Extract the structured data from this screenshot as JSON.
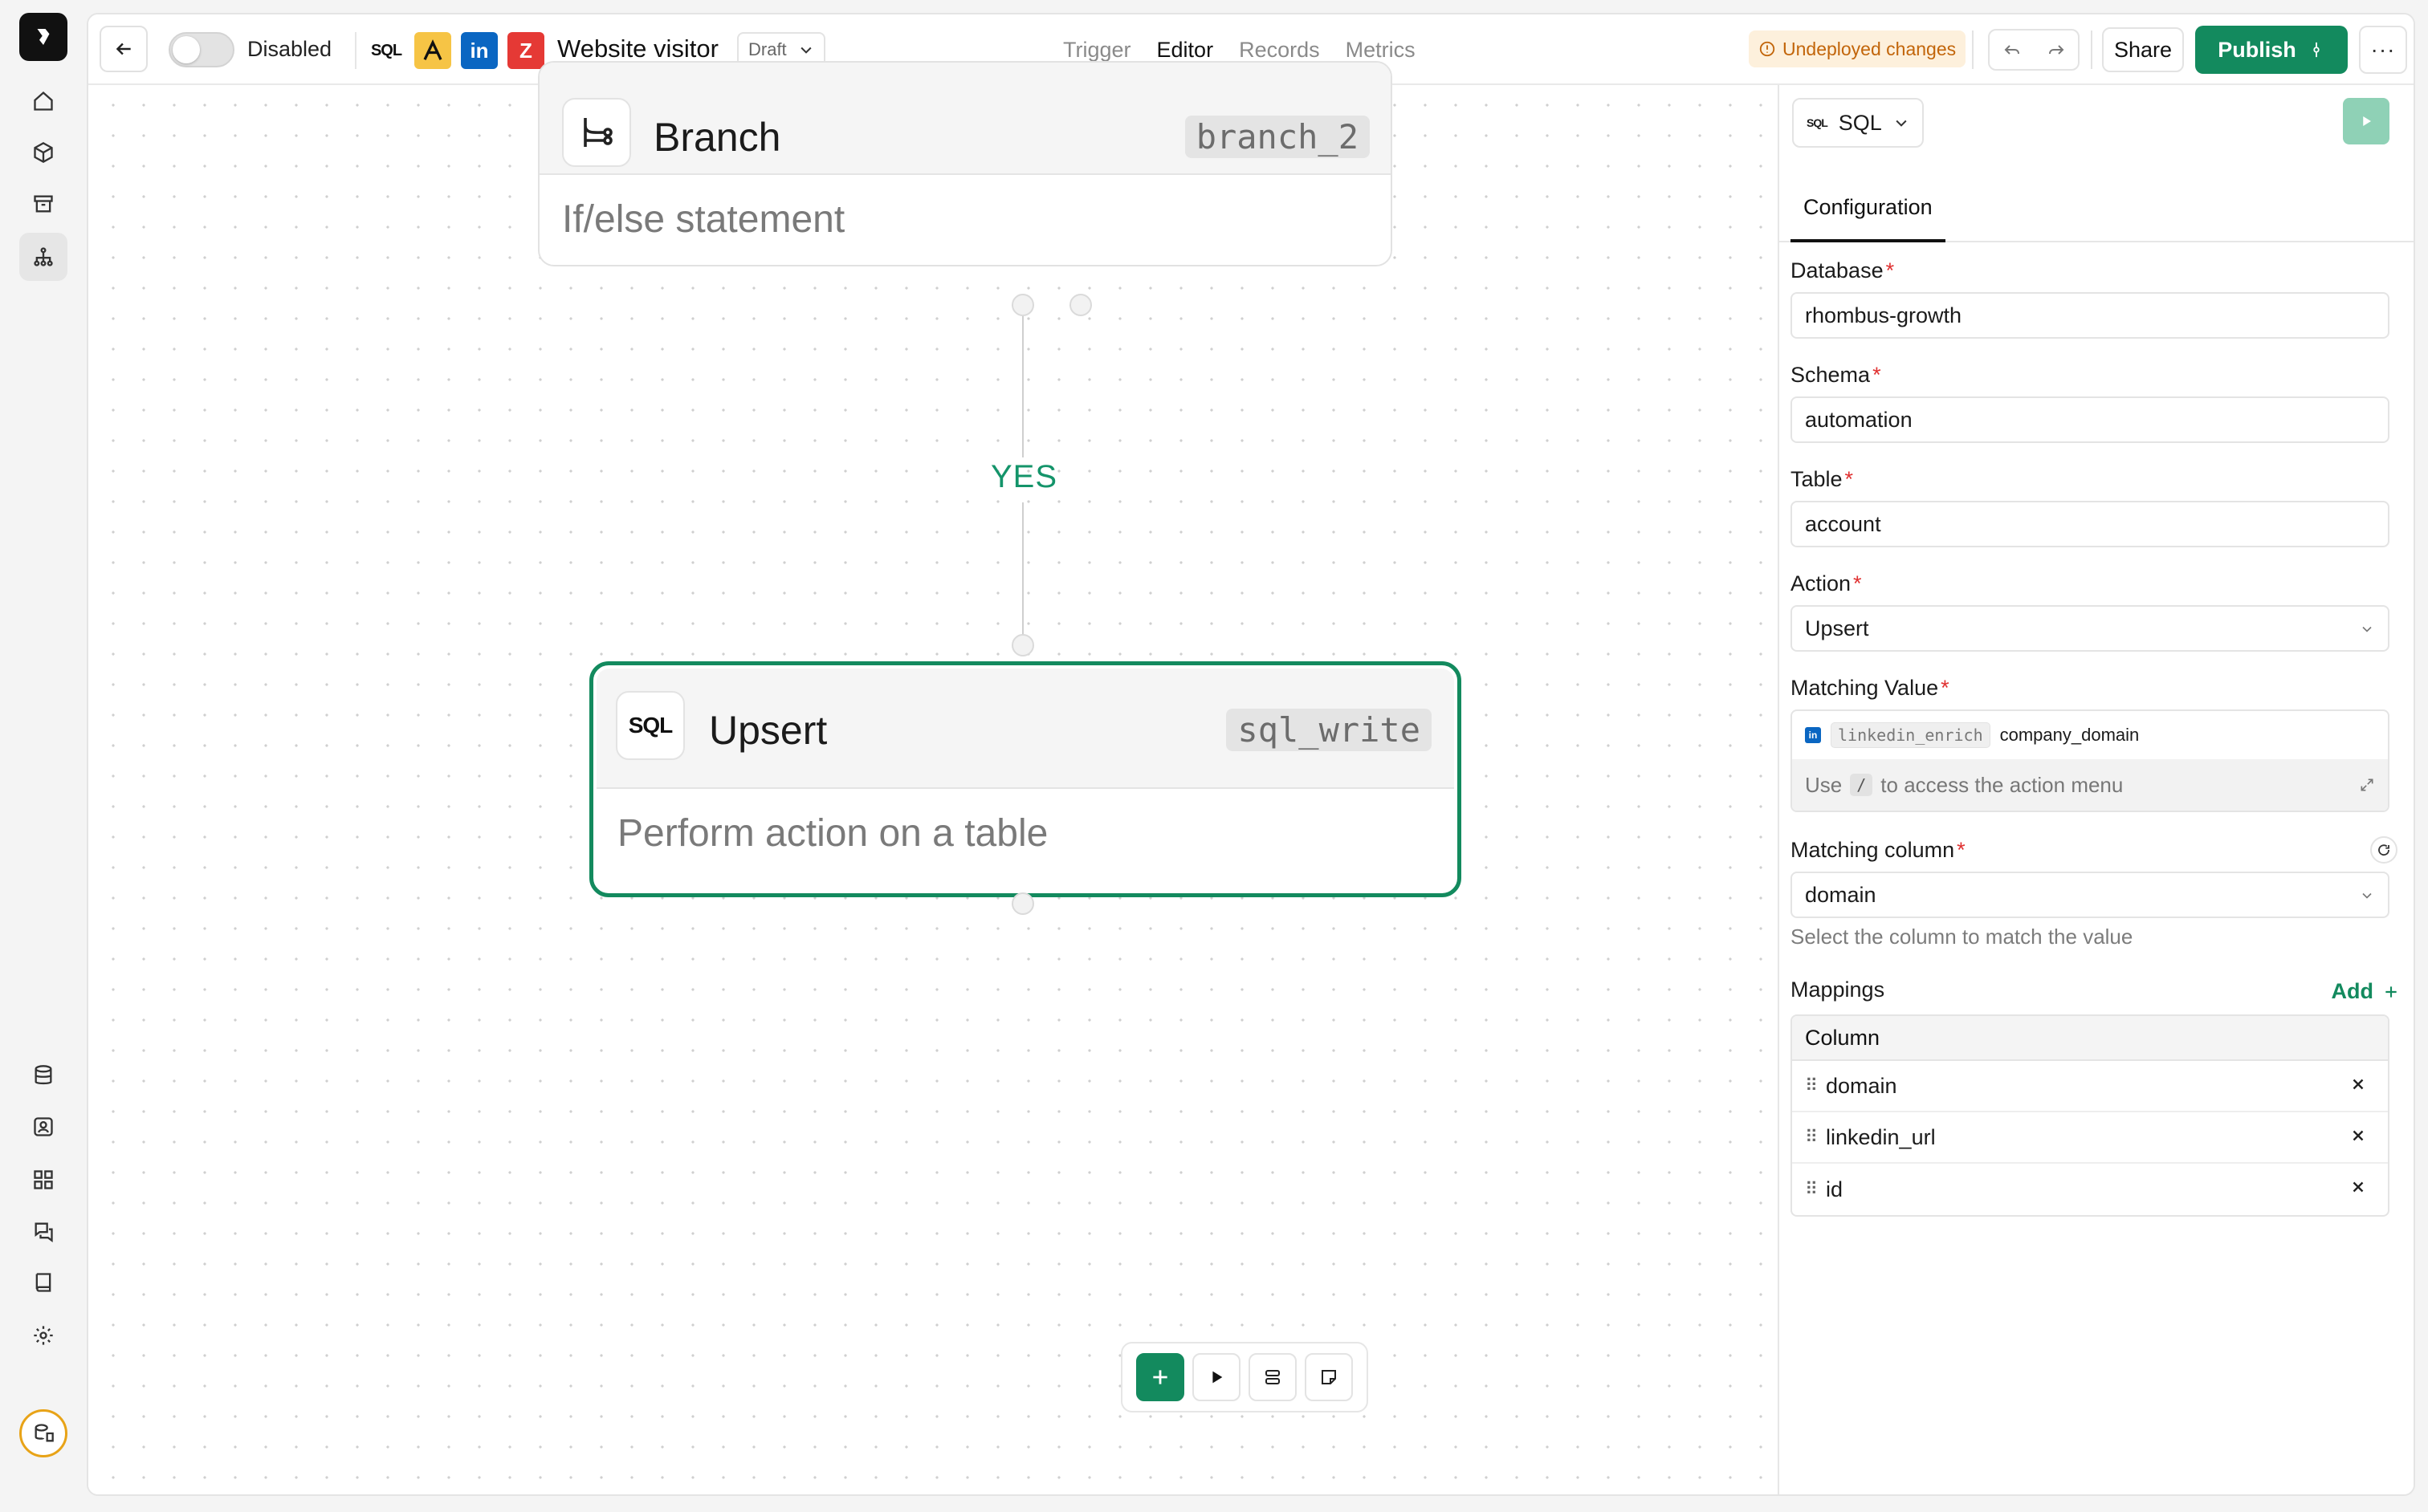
{
  "header": {
    "toggle_label": "Disabled",
    "app_icons": [
      {
        "name": "sql-icon",
        "label": "SQL",
        "color": "#111111"
      },
      {
        "name": "apollo-icon",
        "label": "",
        "color": "#f6c445"
      },
      {
        "name": "linkedin-icon",
        "label": "in",
        "color": "#0a66c2"
      },
      {
        "name": "zoominfo-icon",
        "label": "Z",
        "color": "#e53935"
      }
    ],
    "title": "Website visitor",
    "status_badge": "Draft",
    "tabs": [
      {
        "label": "Trigger",
        "active": false
      },
      {
        "label": "Editor",
        "active": true
      },
      {
        "label": "Records",
        "active": false
      },
      {
        "label": "Metrics",
        "active": false
      }
    ],
    "undeployed": "Undeployed changes",
    "share_label": "Share",
    "publish_label": "Publish",
    "accent_color": "#138a5e",
    "warning_color": "#c2650a"
  },
  "canvas": {
    "branch_node": {
      "title": "Branch",
      "id": "branch_2",
      "description": "If/else statement"
    },
    "edge_label": "YES",
    "upsert_node": {
      "title": "Upsert",
      "id": "sql_write",
      "description": "Perform action on a table",
      "icon_label": "SQL"
    }
  },
  "panel": {
    "connector_label": "SQL",
    "connector_icon_label": "SQL",
    "tab_label": "Configuration",
    "fields": {
      "database": {
        "label": "Database",
        "value": "rhombus-growth"
      },
      "schema": {
        "label": "Schema",
        "value": "automation"
      },
      "table": {
        "label": "Table",
        "value": "account"
      },
      "action": {
        "label": "Action",
        "value": "Upsert"
      },
      "matching_value": {
        "label": "Matching Value",
        "chip_source": "linkedin_enrich",
        "chip_field": "company_domain",
        "hint_before": "Use",
        "hint_key": "/",
        "hint_after": "to access the action menu"
      },
      "matching_column": {
        "label": "Matching column",
        "value": "domain",
        "help": "Select the column to match the value"
      }
    },
    "mappings": {
      "label": "Mappings",
      "add_label": "Add",
      "column_header": "Column",
      "rows": [
        "domain",
        "linkedin_url",
        "id"
      ]
    }
  }
}
